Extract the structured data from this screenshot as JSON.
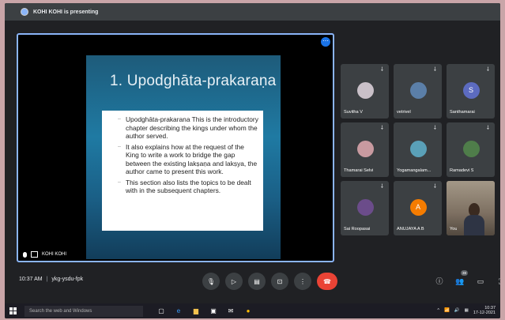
{
  "presenting_bar": {
    "text": "KOHI KOHI is presenting"
  },
  "main_tile": {
    "presenter_name": "KOHI KOHI",
    "slide": {
      "title": "1. Upodghāta-prakaraṇa",
      "bullets": [
        "Upodghāta-prakarana This is the introductory chapter describing the kings under whom the author served.",
        "It also explains how at the request of the King to write a work to bridge the gap between the existing lakṣaṇa and lakṣya, the author came to present this work.",
        "This section also lists the topics to be dealt with in the subsequent chapters."
      ]
    }
  },
  "participants": [
    {
      "name": "Suvitha V",
      "initial": "",
      "color": "#c9c0c8"
    },
    {
      "name": "vetrivel",
      "initial": "",
      "color": "#5b7fa8"
    },
    {
      "name": "Santhamarai",
      "initial": "S",
      "color": "#5c6bc0"
    },
    {
      "name": "Thamarai Selvi",
      "initial": "",
      "color": "#c89aa0"
    },
    {
      "name": "Yogamangalam...",
      "initial": "",
      "color": "#5aa0b8"
    },
    {
      "name": "Ramadevi S",
      "initial": "",
      "color": "#4f7d4a"
    },
    {
      "name": "Sai Roopasai",
      "initial": "",
      "color": "#6b4c8a"
    },
    {
      "name": "ANUJAYA A B",
      "initial": "A",
      "color": "#f57c00"
    },
    {
      "name": "You",
      "initial": "",
      "color": ""
    }
  ],
  "meeting": {
    "time": "10:37 AM",
    "separator": "|",
    "code": "ykg-ysdu-fpk"
  },
  "controls": {
    "participants_count": "38"
  },
  "taskbar": {
    "search_placeholder": "Search the web and Windows",
    "clock_time": "10:37",
    "clock_date": "17-12-2021"
  }
}
